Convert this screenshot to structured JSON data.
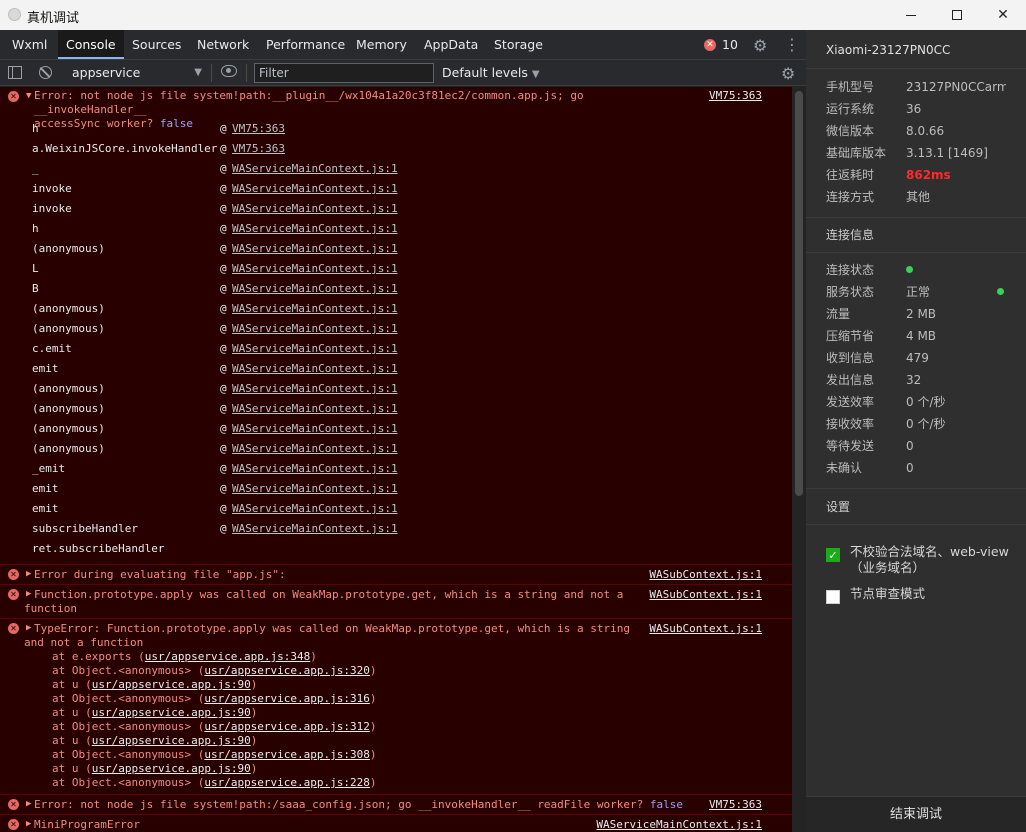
{
  "window": {
    "title": "真机调试"
  },
  "tabs": [
    {
      "label": "Wxml",
      "active": false
    },
    {
      "label": "Console",
      "active": true
    },
    {
      "label": "Sources",
      "active": false
    },
    {
      "label": "Network",
      "active": false
    },
    {
      "label": "Performance",
      "active": false
    },
    {
      "label": "Memory",
      "active": false
    },
    {
      "label": "AppData",
      "active": false
    },
    {
      "label": "Storage",
      "active": false
    }
  ],
  "error_count": "10",
  "toolbar": {
    "context": "appservice",
    "filter_placeholder": "Filter",
    "levels": "Default levels"
  },
  "messages": {
    "m1": {
      "text": "Error: not node js file system!path:__plugin__/wx104a1a20c3f81ec2/common.app.js; go __invokeHandler__\naccessSync worker? ",
      "kw": "false",
      "src": "VM75:363",
      "trace": [
        {
          "fn": "h",
          "loc": "VM75:363"
        },
        {
          "fn": "a.WeixinJSCore.invokeHandler",
          "loc": "VM75:363"
        },
        {
          "fn": "_",
          "loc": "WAServiceMainContext.js:1"
        },
        {
          "fn": "invoke",
          "loc": "WAServiceMainContext.js:1"
        },
        {
          "fn": "invoke",
          "loc": "WAServiceMainContext.js:1"
        },
        {
          "fn": "h",
          "loc": "WAServiceMainContext.js:1"
        },
        {
          "fn": "(anonymous)",
          "loc": "WAServiceMainContext.js:1"
        },
        {
          "fn": "L",
          "loc": "WAServiceMainContext.js:1"
        },
        {
          "fn": "B",
          "loc": "WAServiceMainContext.js:1"
        },
        {
          "fn": "(anonymous)",
          "loc": "WAServiceMainContext.js:1"
        },
        {
          "fn": "(anonymous)",
          "loc": "WAServiceMainContext.js:1"
        },
        {
          "fn": "c.emit",
          "loc": "WAServiceMainContext.js:1"
        },
        {
          "fn": "emit",
          "loc": "WAServiceMainContext.js:1"
        },
        {
          "fn": "(anonymous)",
          "loc": "WAServiceMainContext.js:1"
        },
        {
          "fn": "(anonymous)",
          "loc": "WAServiceMainContext.js:1"
        },
        {
          "fn": "(anonymous)",
          "loc": "WAServiceMainContext.js:1"
        },
        {
          "fn": "(anonymous)",
          "loc": "WAServiceMainContext.js:1"
        },
        {
          "fn": "_emit",
          "loc": "WAServiceMainContext.js:1"
        },
        {
          "fn": "emit",
          "loc": "WAServiceMainContext.js:1"
        },
        {
          "fn": "emit",
          "loc": "WAServiceMainContext.js:1"
        },
        {
          "fn": "subscribeHandler",
          "loc": "WAServiceMainContext.js:1"
        },
        {
          "fn": "ret.subscribeHandler",
          "loc": ""
        }
      ]
    },
    "m2": {
      "text": "Error during evaluating file \"app.js\":",
      "src": "WASubContext.js:1"
    },
    "m3": {
      "text": "Function.prototype.apply was called on WeakMap.prototype.get, which is a string and not a\nfunction",
      "src": "WASubContext.js:1"
    },
    "m4": {
      "text": "TypeError: Function.prototype.apply was called on WeakMap.prototype.get, which is a string\nand not a function",
      "src": "WASubContext.js:1",
      "stack": [
        {
          "pre": "at e.exports (",
          "link": "usr/appservice.app.js:348"
        },
        {
          "pre": "at Object.<anonymous> (",
          "link": "usr/appservice.app.js:320"
        },
        {
          "pre": "at u (",
          "link": "usr/appservice.app.js:90"
        },
        {
          "pre": "at Object.<anonymous> (",
          "link": "usr/appservice.app.js:316"
        },
        {
          "pre": "at u (",
          "link": "usr/appservice.app.js:90"
        },
        {
          "pre": "at Object.<anonymous> (",
          "link": "usr/appservice.app.js:312"
        },
        {
          "pre": "at u (",
          "link": "usr/appservice.app.js:90"
        },
        {
          "pre": "at Object.<anonymous> (",
          "link": "usr/appservice.app.js:308"
        },
        {
          "pre": "at u (",
          "link": "usr/appservice.app.js:90"
        },
        {
          "pre": "at Object.<anonymous> (",
          "link": "usr/appservice.app.js:228"
        }
      ]
    },
    "m5": {
      "text": "Error: not node js file system!path:/saaa_config.json; go __invokeHandler__ readFile worker? ",
      "kw": "false",
      "src": "VM75:363"
    },
    "m6": {
      "text": "MiniProgramError",
      "src": "WAServiceMainContext.js:1"
    }
  },
  "panel": {
    "device": "Xiaomi-23127PN0CC",
    "info": [
      {
        "k": "手机型号",
        "v": "23127PN0CCarm..."
      },
      {
        "k": "运行系统",
        "v": "36"
      },
      {
        "k": "微信版本",
        "v": "8.0.66"
      },
      {
        "k": "基础库版本",
        "v": "3.13.1 [1469]"
      },
      {
        "k": "往返耗时",
        "v": "862ms"
      },
      {
        "k": "连接方式",
        "v": "其他"
      }
    ],
    "conn_title": "连接信息",
    "conn": [
      {
        "k": "连接状态",
        "v": ""
      },
      {
        "k": "服务状态",
        "v": "正常"
      },
      {
        "k": "流量",
        "v": "2 MB"
      },
      {
        "k": "压缩节省",
        "v": "4 MB"
      },
      {
        "k": "收到信息",
        "v": "479"
      },
      {
        "k": "发出信息",
        "v": "32"
      },
      {
        "k": "发送效率",
        "v": "0 个/秒"
      },
      {
        "k": "接收效率",
        "v": "0 个/秒"
      },
      {
        "k": "等待发送",
        "v": "0"
      },
      {
        "k": "未确认",
        "v": "0"
      }
    ],
    "settings_title": "设置",
    "opt1": "不校验合法域名、web-view（业务域名）",
    "opt2": "节点审查模式",
    "end_button": "结束调试"
  },
  "colors": {
    "status_green": "#3ad15a",
    "latency_red": "#ff2a2a",
    "checkbox_green": "#1aad19"
  }
}
